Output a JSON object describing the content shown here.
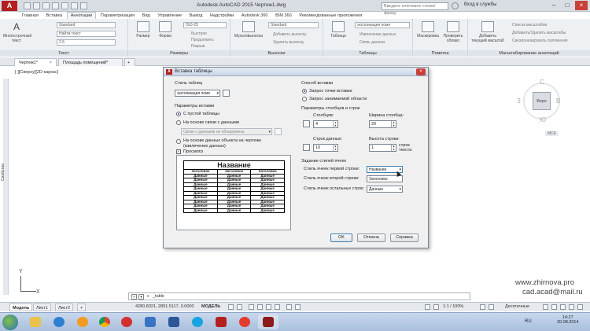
{
  "app": {
    "title": "Autodesk AutoCAD 2015    Чертеж1.dwg",
    "search_placeholder": "Введите ключевое слово/фразу",
    "signin": "Вход в службы",
    "logo": "A"
  },
  "ribbon_tabs": [
    "Главная",
    "Вставка",
    "Аннотации",
    "Параметризация",
    "Вид",
    "Управление",
    "Вывод",
    "Надстройки",
    "Autodesk 360",
    "BIM 360",
    "Рекомендованные приложения"
  ],
  "ribbon": {
    "text_panel": {
      "big1": "Многострочный текст",
      "combo1": "Standard",
      "combo2": "Найти текст",
      "combo3": "2.5",
      "title": "Текст"
    },
    "dims_panel": {
      "big1": "Размер",
      "big2": "Форма",
      "combo1": "ISO-25",
      "mini1": "Быстрое",
      "mini2": "Продолжить",
      "mini3": "Разрыв",
      "title": "Размеры"
    },
    "leaders_panel": {
      "big1": "Мультивыноска",
      "combo1": "Standard",
      "mini1": "Добавить выноску",
      "mini2": "Удалить выноску",
      "title": "Выноски"
    },
    "tables_panel": {
      "big1": "Таблица",
      "combo1": "экспликация поме",
      "mini1": "Извлечение данных",
      "mini2": "Связь данных",
      "title": "Таблицы"
    },
    "markup_panel": {
      "big1": "Маскировка",
      "big2": "Проверить облако",
      "title": "Пометка"
    },
    "scale_panel": {
      "big1": "Добавить текущий масштаб",
      "mini1": "Список масштабов",
      "mini2": "Добавить/Удалить масштабы",
      "mini3": "Синхронизировать положения",
      "title": "Масштабирование аннотаций"
    }
  },
  "doc_tabs": {
    "tab1": "Чертеж1*",
    "tab2": "Площадь помещений*"
  },
  "viewport": {
    "label": "[-][Сверху][2D-каркас]",
    "side_label": "Свойства"
  },
  "viewcube": {
    "north": "С",
    "south": "Ю",
    "west": "З",
    "east": "В",
    "face": "Верх",
    "msk": "МСК"
  },
  "ucs": {
    "x": "X",
    "y": "Y"
  },
  "watermark": {
    "line1": "www.zhirnova.pro",
    "line2": "cad.acad@mail.ru"
  },
  "command": {
    "text": "_table",
    "prompt": "≡"
  },
  "status": {
    "layout_tabs": [
      "Модель",
      "Лист1",
      "Лист2"
    ],
    "coords": "4280.8321, 2891.5117, 0.0000",
    "model": "МОДЕЛЬ",
    "scale": "1:1 / 100%",
    "units": "Десятичные"
  },
  "taskbar": {
    "lang": "RU",
    "time": "14:27",
    "date": "20.08.2014"
  },
  "dialog": {
    "title": "Вставка таблицы",
    "table_style_label": "Стиль таблиц",
    "table_style_value": "экспликация поме",
    "insert_params_label": "Параметры вставки",
    "opt_empty": "С пустой таблицы",
    "opt_link": "На основе связи с данными",
    "link_combo": "Связи с данными не обнаружены",
    "opt_objects": "На основе данных объекта на чертеже (извлечение данных)",
    "preview_label": "Просмотр",
    "insert_method_label": "Способ вставки",
    "opt_point": "Запрос точки вставки",
    "opt_window": "Запрос занимаемой области",
    "colrow_label": "Параметры столбцов и строк",
    "columns_label": "Столбцов:",
    "columns_value": "4",
    "col_width_label": "Ширина столбца:",
    "col_width_value": "20",
    "data_rows_label": "Строк данных:",
    "data_rows_value": "10",
    "row_height_label": "Высота строки:",
    "row_height_value": "1",
    "row_height_unit": "строк текста",
    "cell_styles_label": "Задание стилей ячеек",
    "first_row_label": "Стиль ячеек первой строки:",
    "first_row_value": "Название",
    "second_row_label": "Стиль ячеек второй строки:",
    "second_row_value": "Заголовок",
    "other_rows_label": "Стиль ячеек остальных строк:",
    "other_rows_value": "Данные",
    "ok": "OK",
    "cancel": "Отмена",
    "help": "Справка",
    "preview": {
      "title": "Название",
      "header": [
        "Заголовок",
        "Заголовок",
        "Заголовок"
      ],
      "cell": "Данные",
      "row_count": 9
    }
  }
}
